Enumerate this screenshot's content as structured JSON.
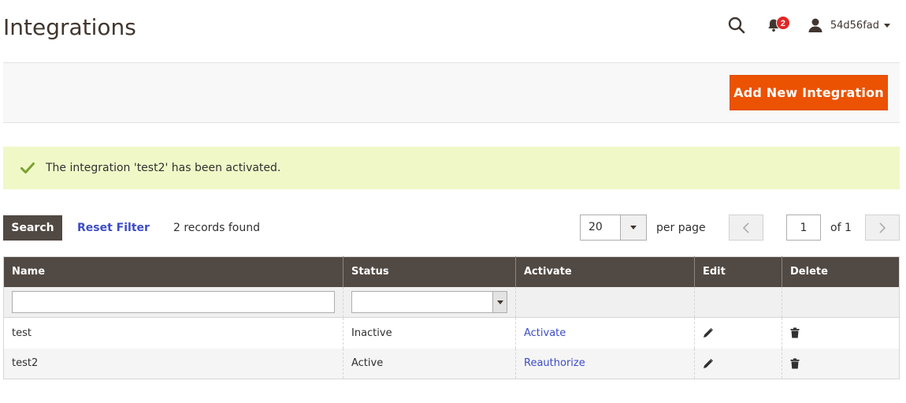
{
  "page": {
    "title": "Integrations"
  },
  "header": {
    "notifications_count": "2",
    "username": "54d56fad"
  },
  "actions": {
    "add_new_label": "Add New Integration"
  },
  "message": {
    "text": "The integration 'test2' has been activated."
  },
  "grid_toolbar": {
    "search_label": "Search",
    "reset_label": "Reset Filter",
    "records_found": "2 records found",
    "per_page_value": "20",
    "per_page_label": "per page",
    "current_page": "1",
    "of_pages": "of 1"
  },
  "grid": {
    "columns": [
      "Name",
      "Status",
      "Activate",
      "Edit",
      "Delete"
    ],
    "rows": [
      {
        "name": "test",
        "status": "Inactive",
        "activate": "Activate"
      },
      {
        "name": "test2",
        "status": "Active",
        "activate": "Reauthorize"
      }
    ]
  },
  "colors": {
    "primary_button": "#eb5202",
    "header_dark": "#514943",
    "link": "#3d4cc6",
    "success_bg": "#f0f8c8",
    "success_icon": "#79a22e",
    "badge": "#e22626"
  },
  "icons": [
    "search-icon",
    "bell-icon",
    "user-icon",
    "check-icon",
    "chevron-left-icon",
    "chevron-right-icon",
    "pencil-icon",
    "trash-icon"
  ]
}
